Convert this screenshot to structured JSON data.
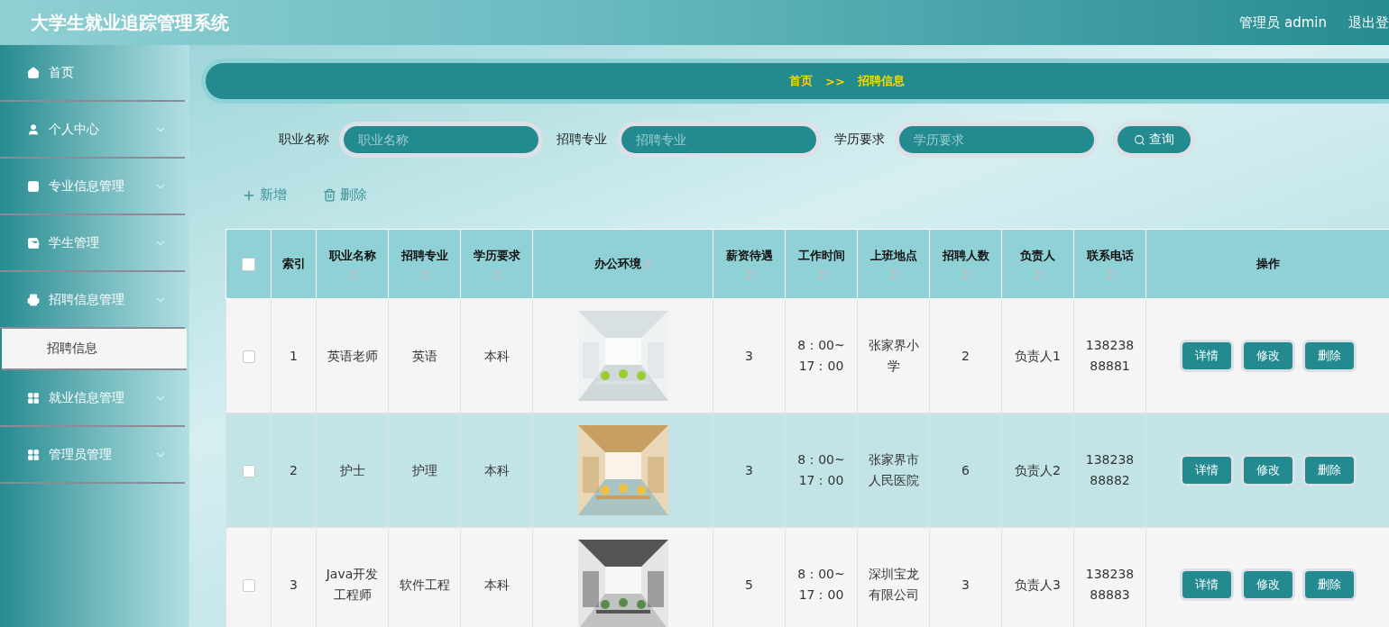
{
  "header": {
    "title": "大学生就业追踪管理系统",
    "user": "管理员 admin",
    "logout": "退出登"
  },
  "sidebar": {
    "items": [
      {
        "label": "首页",
        "chevron": false
      },
      {
        "label": "个人中心",
        "chevron": true
      },
      {
        "label": "专业信息管理",
        "chevron": true
      },
      {
        "label": "学生管理",
        "chevron": true
      },
      {
        "label": "招聘信息管理",
        "chevron": true,
        "children": [
          {
            "label": "招聘信息",
            "selected": true
          }
        ]
      },
      {
        "label": "就业信息管理",
        "chevron": true
      },
      {
        "label": "管理员管理",
        "chevron": true
      }
    ]
  },
  "breadcrumb": {
    "home": "首页",
    "separator": ">>",
    "current": "招聘信息"
  },
  "search": {
    "fields": [
      {
        "label": "职业名称",
        "placeholder": "职业名称"
      },
      {
        "label": "招聘专业",
        "placeholder": "招聘专业"
      },
      {
        "label": "学历要求",
        "placeholder": "学历要求"
      }
    ],
    "button": "查询"
  },
  "actions": {
    "add": "新增",
    "delete": "删除"
  },
  "table": {
    "select_all": {
      "checked": false
    },
    "columns": [
      {
        "label": "索引",
        "sortable": false,
        "kind": "index"
      },
      {
        "label": "职业名称",
        "sortable": true,
        "kind": "text"
      },
      {
        "label": "招聘专业",
        "sortable": true,
        "kind": "text"
      },
      {
        "label": "学历要求",
        "sortable": true,
        "kind": "text"
      },
      {
        "label": "办公环境",
        "sortable": true
      },
      {
        "label": "薪资待遇",
        "sortable": true,
        "kind": "text"
      },
      {
        "label": "工作时间",
        "sortable": true,
        "kind": "text"
      },
      {
        "label": "上班地点",
        "sortable": true,
        "kind": "text"
      },
      {
        "label": "招聘人数",
        "sortable": true,
        "kind": "text"
      },
      {
        "label": "负责人",
        "sortable": true,
        "kind": "text"
      },
      {
        "label": "联系电话",
        "sortable": true,
        "kind": "text"
      },
      {
        "label": "操作",
        "sortable": false,
        "kind": "ops"
      }
    ],
    "rows": [
      {
        "checked": false,
        "cells": [
          "1",
          "英语老师",
          "英语",
          "本科",
          "",
          "3",
          "8：00~17：00",
          "张家界小学",
          "2",
          "负责人1",
          "13823888881"
        ],
        "actions": [
          "详情",
          "修改",
          "删除"
        ]
      },
      {
        "checked": false,
        "cells": [
          "2",
          "护士",
          "护理",
          "本科",
          "",
          "3",
          "8：00~17：00",
          "张家界市人民医院",
          "6",
          "负责人2",
          "13823888882"
        ],
        "actions": [
          "详情",
          "修改",
          "删除"
        ]
      },
      {
        "checked": false,
        "cells": [
          "3",
          "Java开发工程师",
          "软件工程",
          "本科",
          "",
          "5",
          "8：00~17：00",
          "深圳宝龙有限公司",
          "3",
          "负责人3",
          "13823888883"
        ],
        "actions": [
          "详情",
          "修改",
          "删除"
        ]
      }
    ]
  }
}
